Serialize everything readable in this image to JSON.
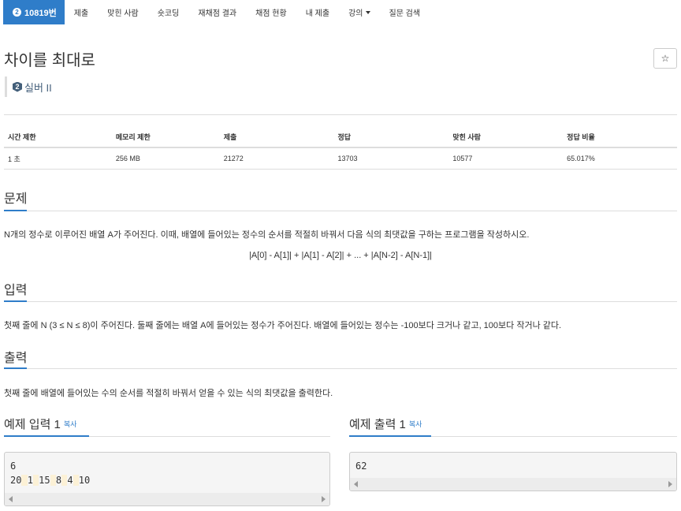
{
  "nav": {
    "active_badge": "2",
    "active_label": "10819번",
    "items": [
      "제출",
      "맞힌 사람",
      "숏코딩",
      "재채점 결과",
      "채점 현황",
      "내 제출",
      "강의",
      "질문 검색"
    ]
  },
  "problem": {
    "title": "차이를 최대로",
    "star": "☆",
    "tier_icon": "2",
    "tier_label": "실버 II"
  },
  "info": {
    "headers": [
      "시간 제한",
      "메모리 제한",
      "제출",
      "정답",
      "맞힌 사람",
      "정답 비율"
    ],
    "values": [
      "1 초",
      "256 MB",
      "21272",
      "13703",
      "10577",
      "65.017%"
    ]
  },
  "sections": {
    "problem_h": "문제",
    "problem_text": "N개의 정수로 이루어진 배열 A가 주어진다. 이때, 배열에 들어있는 정수의 순서를 적절히 바꿔서 다음 식의 최댓값을 구하는 프로그램을 작성하시오.",
    "formula": "|A[0] - A[1]| + |A[1] - A[2]| + ... + |A[N-2] - A[N-1]|",
    "input_h": "입력",
    "input_text": "첫째 줄에 N (3 ≤ N ≤ 8)이 주어진다. 둘째 줄에는 배열 A에 들어있는 정수가 주어진다. 배열에 들어있는 정수는 -100보다 크거나 같고, 100보다 작거나 같다.",
    "output_h": "출력",
    "output_text": "첫째 줄에 배열에 들어있는 수의 순서를 적절히 바꿔서 얻을 수 있는 식의 최댓값을 출력한다."
  },
  "examples": {
    "input_h": "예제 입력 1",
    "output_h": "예제 출력 1",
    "copy_label": "복사",
    "input_line1": "6",
    "input_line2": [
      "20",
      "1",
      "15",
      "8",
      "4",
      "10"
    ],
    "output_line1": "62"
  }
}
